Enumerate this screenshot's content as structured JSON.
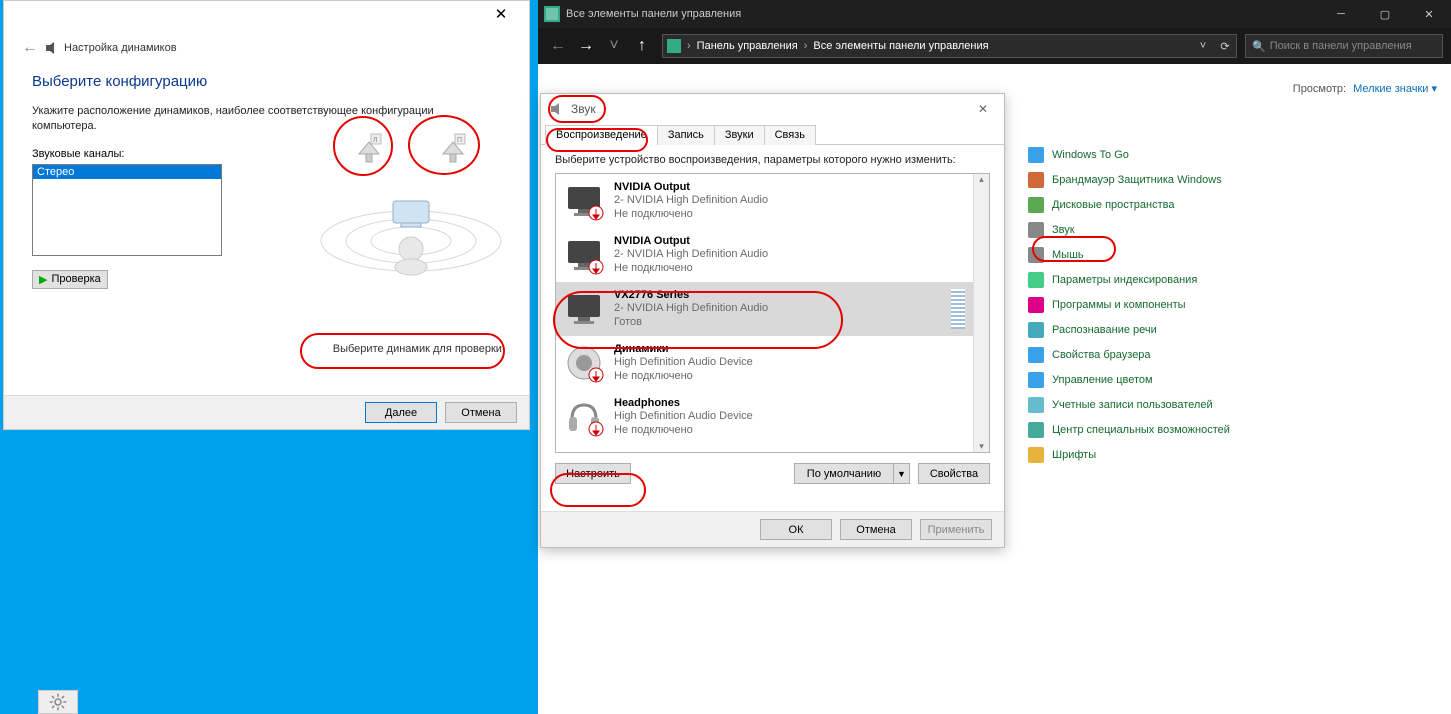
{
  "speaker": {
    "back_tooltip": "Назад",
    "window_title": "Настройка динамиков",
    "heading": "Выберите конфигурацию",
    "subtitle": "Укажите расположение динамиков, наиболее соответствующее конфигурации компьютера.",
    "channels_label": "Звуковые каналы:",
    "channels": [
      "Стерео"
    ],
    "selected_channel": "Стерео",
    "test_btn": "Проверка",
    "info_text": "Выберите динамик для проверки.",
    "next_btn": "Далее",
    "cancel_btn": "Отмена"
  },
  "cp": {
    "titlebar": "Все элементы панели управления",
    "crumb1": "Панель управления",
    "crumb2": "Все элементы панели управления",
    "search_placeholder": "Поиск в панели управления",
    "view_label": "Просмотр:",
    "view_value": "Мелкие значки",
    "items": [
      {
        "label": "Windows To Go",
        "color": "#3aa0e8"
      },
      {
        "label": "Брандмауэр Защитника Windows",
        "color": "#d06a3a"
      },
      {
        "label": "Дисковые пространства",
        "color": "#5aa84f"
      },
      {
        "label": "Звук",
        "color": "#888"
      },
      {
        "label": "Мышь",
        "color": "#888"
      },
      {
        "label": "Параметры индексирования",
        "color": "#4c8"
      },
      {
        "label": "Программы и компоненты",
        "color": "#d08"
      },
      {
        "label": "Распознавание речи",
        "color": "#4ab"
      },
      {
        "label": "Свойства браузера",
        "color": "#3aa0e8"
      },
      {
        "label": "Управление цветом",
        "color": "#3aa0e8"
      },
      {
        "label": "Учетные записи пользователей",
        "color": "#6bc"
      },
      {
        "label": "Центр специальных возможностей",
        "color": "#4a9"
      },
      {
        "label": "Шрифты",
        "color": "#e7b33c"
      }
    ]
  },
  "sound": {
    "title": "Звук",
    "tabs": [
      "Воспроизведение",
      "Запись",
      "Звуки",
      "Связь"
    ],
    "active_tab": 0,
    "hint": "Выберите устройство воспроизведения, параметры которого нужно изменить:",
    "devices": [
      {
        "name": "NVIDIA Output",
        "sub": "2- NVIDIA High Definition Audio",
        "status": "Не подключено",
        "type": "monitor",
        "disconnected": true
      },
      {
        "name": "NVIDIA Output",
        "sub": "2- NVIDIA High Definition Audio",
        "status": "Не подключено",
        "type": "monitor",
        "disconnected": true
      },
      {
        "name": "VX2776 Series",
        "sub": "2- NVIDIA High Definition Audio",
        "status": "Готов",
        "type": "monitor",
        "selected": true
      },
      {
        "name": "Динамики",
        "sub": "High Definition Audio Device",
        "status": "Не подключено",
        "type": "speaker",
        "disconnected": true
      },
      {
        "name": "Headphones",
        "sub": "High Definition Audio Device",
        "status": "Не подключено",
        "type": "headphones",
        "disconnected": true
      }
    ],
    "configure_btn": "Настроить",
    "default_btn": "По умолчанию",
    "properties_btn": "Свойства",
    "ok_btn": "ОК",
    "cancel_btn": "Отмена",
    "apply_btn": "Применить"
  }
}
